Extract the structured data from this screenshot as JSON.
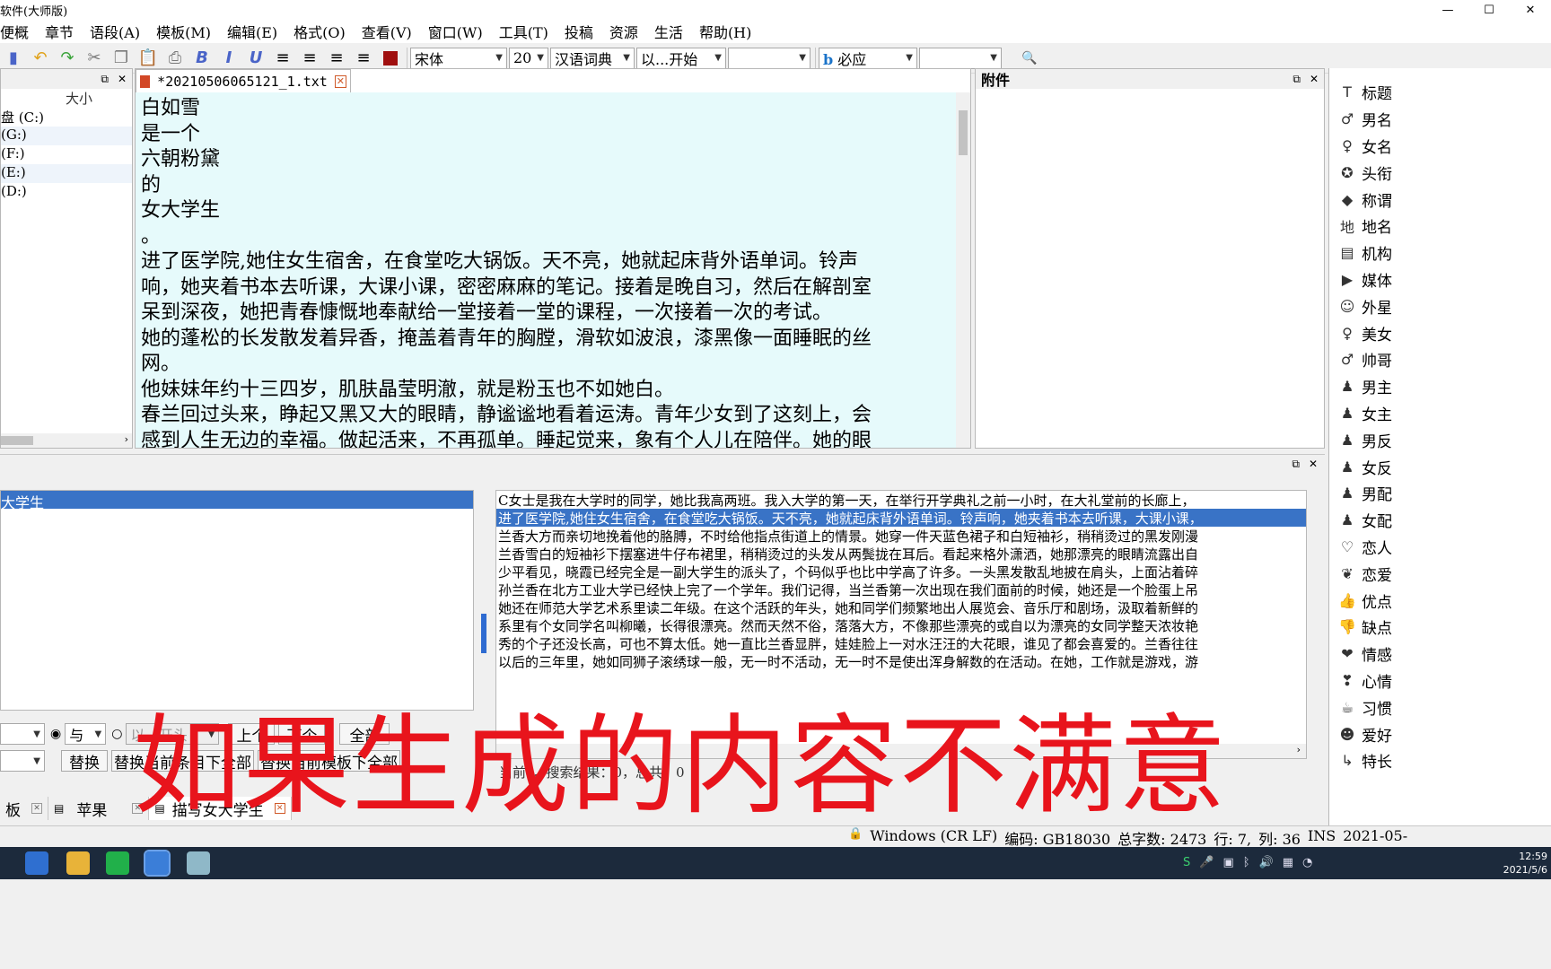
{
  "app": {
    "title": "软件(大师版)"
  },
  "menu": [
    "便概",
    "章节",
    "语段(A)",
    "模板(M)",
    "编辑(E)",
    "格式(O)",
    "查看(V)",
    "窗口(W)",
    "工具(T)",
    "投稿",
    "资源",
    "生活",
    "帮助(H)"
  ],
  "toolbar": {
    "font_name": "宋体",
    "font_size": "20",
    "dictionary": "汉语词典",
    "match_mode": "以...开始",
    "search_engine": "必应",
    "bold": "B",
    "italic": "I",
    "underline": "U"
  },
  "file_panel": {
    "size_header": "大小",
    "drives": [
      "盘 (C:)",
      "(G:)",
      "(F:)",
      "(E:)",
      "(D:)"
    ]
  },
  "editor": {
    "tab_title": "*20210506065121_1.txt",
    "lines": [
      "白如雪",
      "是一个",
      "六朝粉黛",
      "的",
      "女大学生",
      "。",
      "进了医学院,她住女生宿舍，在食堂吃大锅饭。天不亮，她就起床背外语单词。铃声",
      "响，她夹着书本去听课，大课小课，密密麻麻的笔记。接着是晚自习，然后在解剖室",
      "呆到深夜，她把青春慷慨地奉献给一堂接着一堂的课程，一次接着一次的考试。",
      "她的蓬松的长发散发着异香，掩盖着青年的胸膛，滑软如波浪，漆黑像一面睡眠的丝",
      "网。",
      "他妹妹年约十三四岁，肌肤晶莹明澈，就是粉玉也不如她白。",
      "春兰回过头来，睁起又黑又大的眼睛，静谧谧地看着运涛。青年少女到了这刻上，会",
      "感到人生无边的幸福。做起活来，不再孤单。睡起觉来，象有个人儿在陪伴。她的眼"
    ]
  },
  "attach": {
    "title": "附件"
  },
  "tags": [
    {
      "icon": "title-icon",
      "glyph": "T",
      "label": "标题"
    },
    {
      "icon": "male-name-icon",
      "glyph": "♂",
      "label": "男名"
    },
    {
      "icon": "female-name-icon",
      "glyph": "♀",
      "label": "女名"
    },
    {
      "icon": "rank-icon",
      "glyph": "✪",
      "label": "头衔"
    },
    {
      "icon": "tag-icon",
      "glyph": "◆",
      "label": "称谓"
    },
    {
      "icon": "place-icon",
      "glyph": "地",
      "label": "地名"
    },
    {
      "icon": "org-icon",
      "glyph": "▤",
      "label": "机构"
    },
    {
      "icon": "media-icon",
      "glyph": "▶",
      "label": "媒体"
    },
    {
      "icon": "alien-icon",
      "glyph": "☺",
      "label": "外星"
    },
    {
      "icon": "beauty-icon",
      "glyph": "♀",
      "label": "美女"
    },
    {
      "icon": "handsome-icon",
      "glyph": "♂",
      "label": "帅哥"
    },
    {
      "icon": "male-lead-icon",
      "glyph": "♟",
      "label": "男主"
    },
    {
      "icon": "female-lead-icon",
      "glyph": "♟",
      "label": "女主"
    },
    {
      "icon": "male-villain-icon",
      "glyph": "♟",
      "label": "男反"
    },
    {
      "icon": "female-villain-icon",
      "glyph": "♟",
      "label": "女反"
    },
    {
      "icon": "male-support-icon",
      "glyph": "♟",
      "label": "男配"
    },
    {
      "icon": "female-support-icon",
      "glyph": "♟",
      "label": "女配"
    },
    {
      "icon": "lover-icon",
      "glyph": "♡",
      "label": "恋人"
    },
    {
      "icon": "love-icon",
      "glyph": "❦",
      "label": "恋爱"
    },
    {
      "icon": "thumbs-up-icon",
      "glyph": "👍",
      "label": "优点"
    },
    {
      "icon": "thumbs-down-icon",
      "glyph": "👎",
      "label": "缺点"
    },
    {
      "icon": "emotion-icon",
      "glyph": "❤",
      "label": "情感"
    },
    {
      "icon": "mood-icon",
      "glyph": "❣",
      "label": "心情"
    },
    {
      "icon": "habit-icon",
      "glyph": "☕",
      "label": "习惯"
    },
    {
      "icon": "hobby-icon",
      "glyph": "☻",
      "label": "爱好"
    },
    {
      "icon": "skill-icon",
      "glyph": "↳",
      "label": "特长"
    }
  ],
  "list": {
    "selected": "大学生"
  },
  "context_lines": [
    {
      "text": "C女士是我在大学时的同学，她比我高两班。我入大学的第一天，在举行开学典礼之前一小时，在大礼堂前的长廊上，",
      "hl": false
    },
    {
      "text": "进了医学院,她住女生宿舍，在食堂吃大锅饭。天不亮，她就起床背外语单词。铃声响，她夹着书本去听课，大课小课，",
      "hl": true
    },
    {
      "text": "兰香大方而亲切地挽着他的胳膊，不时给他指点街道上的情景。她穿一件天蓝色裙子和白短袖衫，稍稍烫过的黑发刚漫",
      "hl": false
    },
    {
      "text": "兰香雪白的短袖衫下摆塞进牛仔布裙里，稍稍烫过的头发从两鬓拢在耳后。看起来格外潇洒，她那漂亮的眼睛流露出自",
      "hl": false
    },
    {
      "text": "少平看见，晓霞已经完全是一副大学生的派头了，个码似乎也比中学高了许多。一头黑发散乱地披在肩头，上面沾着碎",
      "hl": false
    },
    {
      "text": "孙兰香在北方工业大学已经快上完了一个学年。我们记得，当兰香第一次出现在我们面前的时候，她还是一个脸蛋上吊",
      "hl": false
    },
    {
      "text": "她还在师范大学艺术系里读二年级。在这个活跃的年头，她和同学们频繁地出人展览会、音乐厅和剧场，汲取着新鲜的",
      "hl": false
    },
    {
      "text": "系里有个女同学名叫柳曦，长得很漂亮。然而天然不俗，落落大方，不像那些漂亮的或自以为漂亮的女同学整天浓妆艳",
      "hl": false
    },
    {
      "text": "秀的个子还没长高，可也不算太低。她一直比兰香显胖，娃娃脸上一对水汪汪的大花眼，谁见了都会喜爱的。兰香往往",
      "hl": false
    },
    {
      "text": "以后的三年里，她如同狮子滚绣球一般，无一时不活动，无一时不是使出浑身解数的在活动。在她，工作就是游戏，游",
      "hl": false
    }
  ],
  "search_controls": {
    "radio_and": "与",
    "radio_or": "以...开头",
    "prev_button": "上个",
    "next_button": "下个",
    "all_button": "全部",
    "replace_button": "替换",
    "replace_current_button": "替换当前条目下全部",
    "replace_template_button": "替换当前模板下全部",
    "result_text": "当前：，搜索结果：0，总共：0"
  },
  "doc_tabs": [
    {
      "label": "板",
      "active": false
    },
    {
      "label": "苹果",
      "active": false
    },
    {
      "label": "描写女大学生",
      "active": true
    }
  ],
  "status": {
    "line_ending": "Windows (CR LF)",
    "encoding": "编码: GB18030",
    "word_count": "总字数: 2473",
    "row": "行: 7,",
    "col": "列: 36",
    "mode": "INS",
    "date": "2021-05-"
  },
  "taskbar": {
    "time": "12:59",
    "date": "2021/5/6"
  },
  "overlay": {
    "caption": "如果生成的内容不满意"
  }
}
